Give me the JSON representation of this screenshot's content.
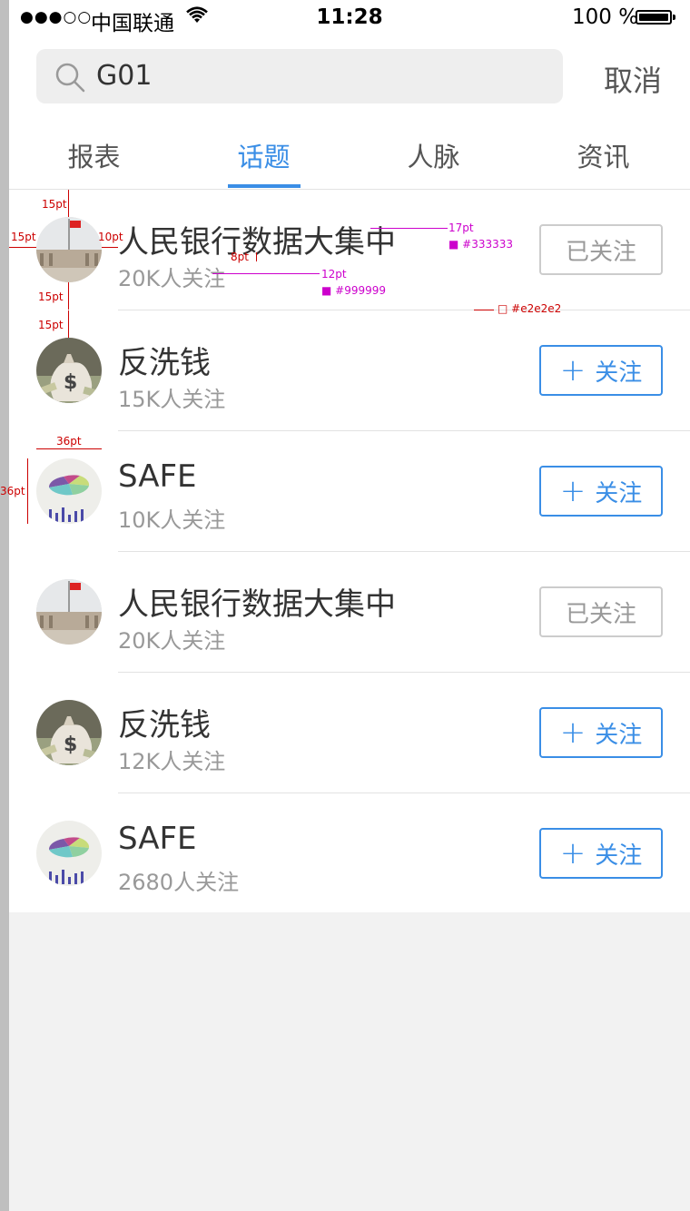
{
  "status_bar": {
    "signal": "●●●○○",
    "carrier": "中国联通",
    "time": "11:28",
    "battery": "100 %"
  },
  "search": {
    "value": "G01",
    "cancel_label": "取消"
  },
  "tabs": [
    {
      "label": "报表",
      "active": false
    },
    {
      "label": "话题",
      "active": true
    },
    {
      "label": "人脉",
      "active": false
    },
    {
      "label": "资讯",
      "active": false
    }
  ],
  "topics": [
    {
      "title": "人民银行数据大集中",
      "followers": "20K人关注",
      "button": "已关注",
      "followed": true,
      "icon": "pboc-building-image"
    },
    {
      "title": "反洗钱",
      "followers": "15K人关注",
      "button": "关注",
      "followed": false,
      "icon": "money-bag-image"
    },
    {
      "title": "SAFE",
      "followers": "10K人关注",
      "button": "关注",
      "followed": false,
      "icon": "pie-chart-image"
    },
    {
      "title": "人民银行数据大集中",
      "followers": "20K人关注",
      "button": "已关注",
      "followed": true,
      "icon": "pboc-building-image"
    },
    {
      "title": "反洗钱",
      "followers": "12K人关注",
      "button": "关注",
      "followed": false,
      "icon": "money-bag-image"
    },
    {
      "title": "SAFE",
      "followers": "2680人关注",
      "button": "关注",
      "followed": false,
      "icon": "pie-chart-image"
    }
  ],
  "annotations": {
    "top_margin": "15pt",
    "left_margin": "15pt",
    "right_gap": "10pt",
    "line_gap": "8pt",
    "bottom_margin": "15pt",
    "next_top_margin": "15pt",
    "title_size": "17pt",
    "title_color": "#333333",
    "sub_size": "12pt",
    "sub_color": "#999999",
    "divider_color": "#e2e2e2",
    "avatar_width": "36pt",
    "avatar_height": "36pt"
  },
  "colors": {
    "accent": "#3a8ee6",
    "text": "#333333",
    "subtext": "#999999",
    "divider": "#e2e2e2",
    "followed_border": "#cccccc"
  }
}
